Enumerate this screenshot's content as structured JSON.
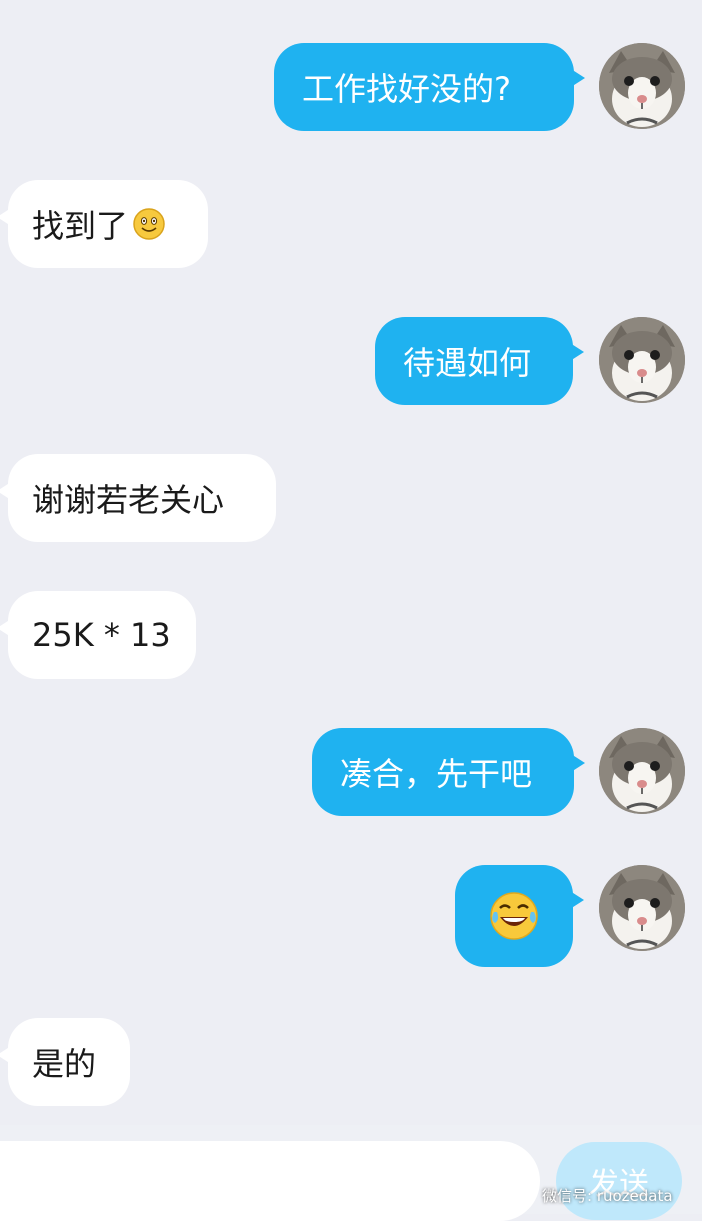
{
  "colors": {
    "background": "#edeef4",
    "outgoing_bubble": "#1fb2f0",
    "incoming_bubble": "#ffffff",
    "send_button": "#bfe8fb"
  },
  "messages": [
    {
      "direction": "outgoing",
      "text": "工作找好没的?",
      "avatar": "cat-avatar"
    },
    {
      "direction": "incoming",
      "text": "找到了",
      "emoji": "smiling-face-emoji"
    },
    {
      "direction": "outgoing",
      "text": "待遇如何",
      "avatar": "cat-avatar"
    },
    {
      "direction": "incoming",
      "text": "谢谢若老关心"
    },
    {
      "direction": "incoming",
      "text": "25K * 13"
    },
    {
      "direction": "outgoing",
      "text": "凑合，先干吧",
      "avatar": "cat-avatar"
    },
    {
      "direction": "outgoing",
      "text": "",
      "emoji": "tears-of-joy-emoji",
      "avatar": "cat-avatar"
    },
    {
      "direction": "incoming",
      "text": "是的"
    }
  ],
  "input": {
    "value": "",
    "send_label": "发送"
  },
  "watermark": {
    "icon": "wechat-icon",
    "text": "微信号: ruozedata"
  }
}
